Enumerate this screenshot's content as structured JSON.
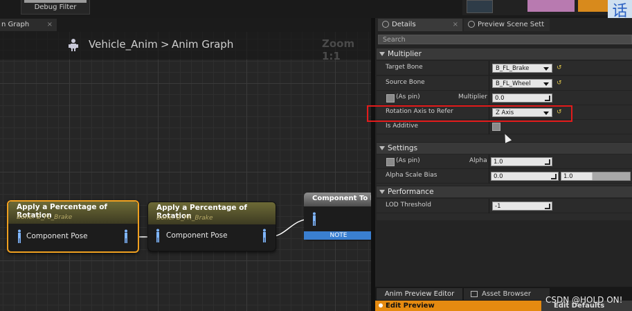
{
  "top": {
    "debug_filter": "Debug Filter",
    "lang_glyph": "话"
  },
  "graph": {
    "tab_label": "n Graph",
    "breadcrumb": {
      "blueprint": "Vehicle_Anim",
      "separator": ">",
      "graph": "Anim Graph"
    },
    "zoom": "Zoom 1:1",
    "nodes": [
      {
        "title": "Apply a Percentage of Rotation",
        "subtitle": "Bone: B_FL_Brake",
        "pin": "Component Pose"
      },
      {
        "title": "Apply a Percentage of Rotation",
        "subtitle": "Bone: B_FR_Brake",
        "pin": "Component Pose"
      },
      {
        "title": "Component To Loc",
        "note": "NOTE"
      }
    ]
  },
  "details": {
    "tab_details": "Details",
    "tab_preview": "Preview Scene Sett",
    "search_placeholder": "Search",
    "multiplier": {
      "header": "Multiplier",
      "target_bone_label": "Target Bone",
      "target_bone_value": "B_FL_Brake",
      "source_bone_label": "Source Bone",
      "source_bone_value": "B_FL_Wheel",
      "as_pin": "(As pin)",
      "multiplier_label": "Multiplier",
      "multiplier_value": "0.0",
      "rotation_axis_label": "Rotation Axis to Refer",
      "rotation_axis_value": "Z Axis",
      "is_additive_label": "Is Additive"
    },
    "settings": {
      "header": "Settings",
      "as_pin": "(As pin)",
      "alpha_label": "Alpha",
      "alpha_value": "1.0",
      "alpha_scale_bias_label": "Alpha Scale Bias",
      "bias_min": "0.0",
      "bias_max": "1.0"
    },
    "performance": {
      "header": "Performance",
      "lod_label": "LOD Threshold",
      "lod_value": "-1"
    }
  },
  "bottom": {
    "anim_preview_tab": "Anim Preview Editor",
    "asset_browser_tab": "Asset Browser",
    "edit_preview": "Edit Preview",
    "edit_defaults": "Edit Defaults",
    "watermark": "CSDN @HOLD ON!"
  }
}
